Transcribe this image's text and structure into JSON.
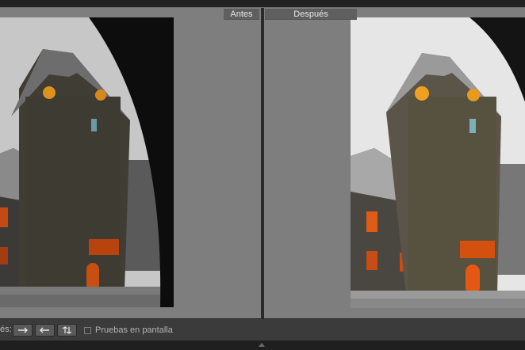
{
  "compare": {
    "before_label": "Antes",
    "after_label": "Después"
  },
  "toolbar": {
    "label": "és:",
    "buttons": [
      "swap-icon",
      "copy-left-icon",
      "swap-sides-icon"
    ],
    "soft_proof_label": "Pruebas en pantalla",
    "soft_proof_checked": false
  },
  "colors": {
    "pane_bg": "#7e7e7e",
    "toolbar_bg": "#3b3b3b",
    "window_accent": "#d9541a"
  }
}
